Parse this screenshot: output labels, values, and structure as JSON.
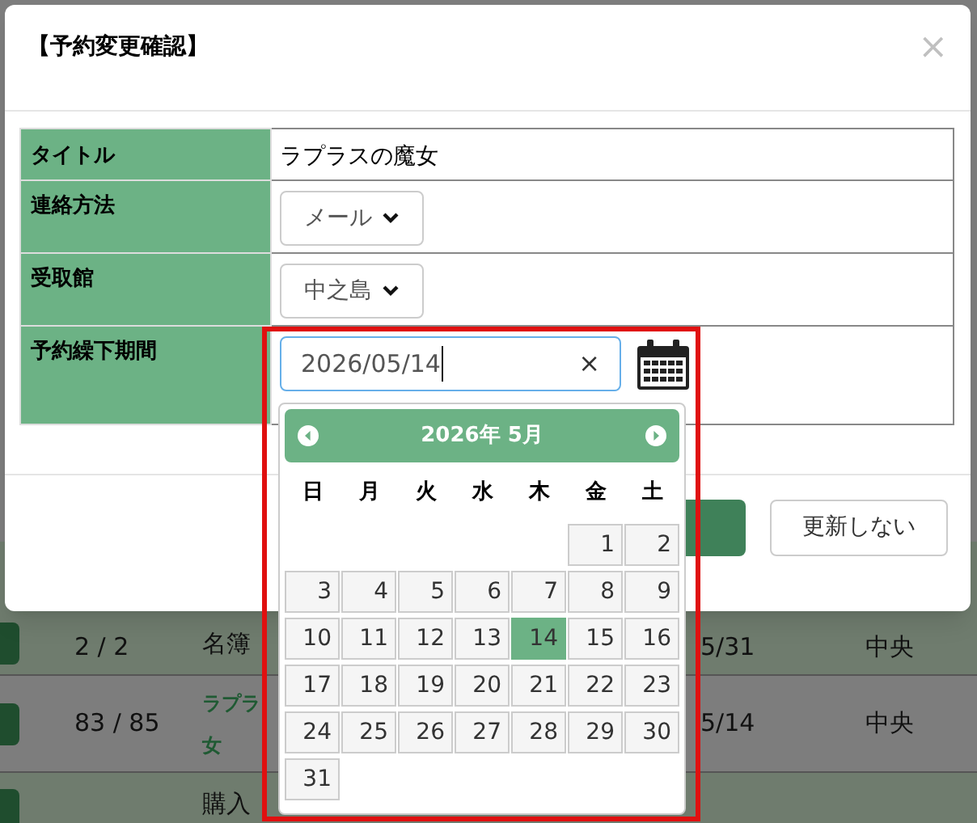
{
  "background_table": {
    "rows": [
      {
        "count": "2 / 2",
        "title_lines": [
          "名簿"
        ],
        "title_bold": false,
        "date": "5/31",
        "library": "中央",
        "shaded": true
      },
      {
        "count": "83 / 85",
        "title_lines": [
          "ラプラ",
          "女"
        ],
        "title_bold": true,
        "date": "5/14",
        "library": "中央",
        "shaded": false
      },
      {
        "title_lines": [
          "購入"
        ],
        "title_bold": false,
        "shaded": true
      }
    ]
  },
  "dialog": {
    "title": "【予約変更確認】",
    "close": "×",
    "fields": [
      {
        "kind": "text",
        "label": "タイトル",
        "value": "ラプラスの魔女"
      },
      {
        "kind": "select",
        "label": "連絡方法",
        "value": "メール"
      },
      {
        "kind": "select",
        "label": "受取館",
        "value": "中之島"
      },
      {
        "kind": "date",
        "label": "予約繰下期間",
        "value": "2026/05/14",
        "clear": "×"
      }
    ],
    "buttons": [
      {
        "kind": "primary"
      },
      {
        "kind": "default",
        "label": "更新しない"
      }
    ]
  },
  "datepicker": {
    "title": "2026年 5月",
    "weekdays": [
      "日",
      "月",
      "火",
      "水",
      "木",
      "金",
      "土"
    ],
    "weeks": [
      {
        "kind": "end",
        "days": [
          {
            "label": "1",
            "selected": false
          },
          {
            "label": "2",
            "selected": false
          }
        ]
      },
      {
        "kind": "full",
        "days": [
          {
            "label": "3",
            "selected": false
          },
          {
            "label": "4",
            "selected": false
          },
          {
            "label": "5",
            "selected": false
          },
          {
            "label": "6",
            "selected": false
          },
          {
            "label": "7",
            "selected": false
          },
          {
            "label": "8",
            "selected": false
          },
          {
            "label": "9",
            "selected": false
          }
        ]
      },
      {
        "kind": "full",
        "days": [
          {
            "label": "10",
            "selected": false
          },
          {
            "label": "11",
            "selected": false
          },
          {
            "label": "12",
            "selected": false
          },
          {
            "label": "13",
            "selected": false
          },
          {
            "label": "14",
            "selected": true
          },
          {
            "label": "15",
            "selected": false
          },
          {
            "label": "16",
            "selected": false
          }
        ]
      },
      {
        "kind": "full",
        "days": [
          {
            "label": "17",
            "selected": false
          },
          {
            "label": "18",
            "selected": false
          },
          {
            "label": "19",
            "selected": false
          },
          {
            "label": "20",
            "selected": false
          },
          {
            "label": "21",
            "selected": false
          },
          {
            "label": "22",
            "selected": false
          },
          {
            "label": "23",
            "selected": false
          }
        ]
      },
      {
        "kind": "full",
        "days": [
          {
            "label": "24",
            "selected": false
          },
          {
            "label": "25",
            "selected": false
          },
          {
            "label": "26",
            "selected": false
          },
          {
            "label": "27",
            "selected": false
          },
          {
            "label": "28",
            "selected": false
          },
          {
            "label": "29",
            "selected": false
          },
          {
            "label": "30",
            "selected": false
          }
        ]
      },
      {
        "kind": "start",
        "days": [
          {
            "label": "31",
            "selected": false
          }
        ]
      }
    ]
  }
}
